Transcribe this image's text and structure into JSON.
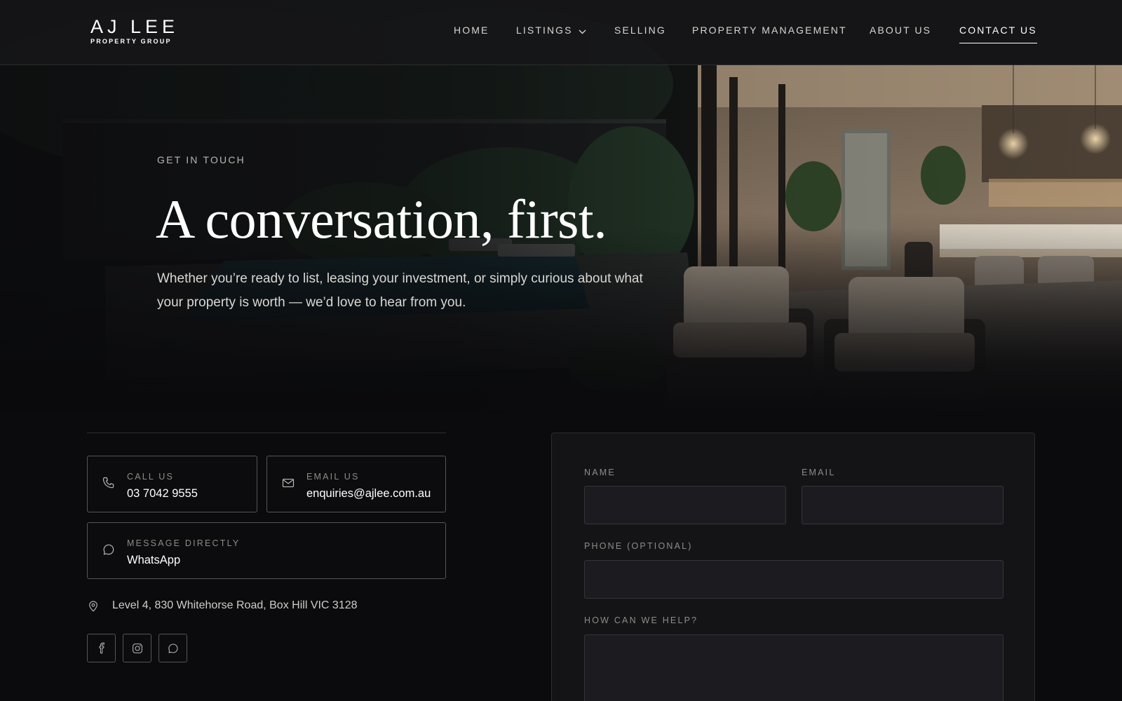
{
  "header": {
    "logo": {
      "name": "AJ LEE",
      "tagline": "PROPERTY GROUP"
    },
    "nav": [
      {
        "label": "HOME"
      },
      {
        "label": "LISTINGS",
        "icon": "chevron-down-icon"
      },
      {
        "label": "SELLING"
      },
      {
        "label": "PROPERTY MANAGEMENT"
      },
      {
        "label": "ABOUT US"
      },
      {
        "label": "CONTACT US",
        "active": true
      }
    ]
  },
  "hero": {
    "eyebrow": "GET IN TOUCH",
    "headline": "A conversation, first.",
    "intro": "Whether you’re ready to list, leasing your investment, or simply curious about what your property is worth — we’d love to hear from you."
  },
  "contact": {
    "call": {
      "label": "CALL US",
      "value": "03 7042 9555",
      "icon": "phone-icon"
    },
    "email": {
      "label": "EMAIL US",
      "value": "enquiries@ajlee.com.au",
      "icon": "mail-icon"
    },
    "message": {
      "label": "MESSAGE DIRECTLY",
      "value": "WhatsApp",
      "icon": "chat-bubble-icon"
    },
    "address": {
      "text": "Level 4, 830 Whitehorse Road, Box Hill VIC 3128",
      "icon": "map-pin-icon"
    },
    "social": [
      {
        "icon": "facebook-icon"
      },
      {
        "icon": "instagram-icon"
      },
      {
        "icon": "whatsapp-icon"
      }
    ]
  },
  "form": {
    "name_label": "NAME",
    "email_label": "EMAIL",
    "phone_label": "PHONE (OPTIONAL)",
    "help_label": "HOW CAN WE HELP?",
    "name_value": "",
    "email_value": "",
    "phone_value": "",
    "help_value": ""
  },
  "colors": {
    "background": "#0b0b0d",
    "panel": "#141417",
    "input": "#1c1c20",
    "border": "#55555a",
    "text": "#ffffff",
    "muted": "#8e8c88"
  }
}
